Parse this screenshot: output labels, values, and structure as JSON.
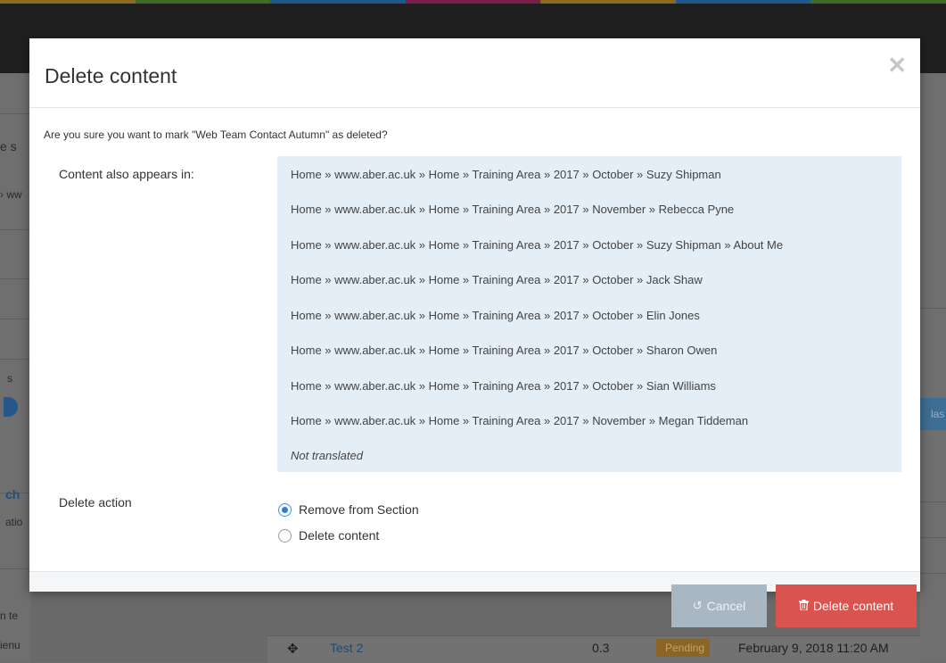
{
  "modal": {
    "title": "Delete content",
    "close_glyph": "✕",
    "question": "Are you sure you want to mark \"Web Team Contact Autumn\" as deleted?",
    "appears_label": "Content also appears in:",
    "appears_in": [
      "Home » www.aber.ac.uk » Home » Training Area » 2017 » October » Suzy Shipman",
      "Home » www.aber.ac.uk » Home » Training Area » 2017 » November » Rebecca Pyne",
      "Home » www.aber.ac.uk » Home » Training Area » 2017 » October » Suzy Shipman » About Me",
      "Home » www.aber.ac.uk » Home » Training Area » 2017 » October » Jack Shaw",
      "Home » www.aber.ac.uk » Home » Training Area » 2017 » October » Elin Jones",
      "Home » www.aber.ac.uk » Home » Training Area » 2017 » October » Sharon Owen",
      "Home » www.aber.ac.uk » Home » Training Area » 2017 » October » Sian Williams",
      "Home » www.aber.ac.uk » Home » Training Area » 2017 » November » Megan Tiddeman"
    ],
    "not_translated": "Not translated",
    "delete_action_label": "Delete action",
    "options": [
      {
        "label": "Remove from Section",
        "checked": true
      },
      {
        "label": "Delete content",
        "checked": false
      }
    ],
    "cancel_label": "Cancel",
    "cancel_icon": "undo-icon",
    "delete_label": "Delete content",
    "delete_icon": "trash-icon"
  },
  "background": {
    "row_title": "Test 2",
    "version": "0.3",
    "status": "Pending",
    "date": "February 9, 2018 11:20 AM",
    "fragments": [
      "e s",
      "› ww",
      "s",
      "ch",
      "atio",
      "n te",
      "ienu",
      "las"
    ]
  },
  "colors": {
    "accent": "#2d7fd6",
    "danger": "#d9534f",
    "cancel": "#a9b7c3",
    "info_box": "#e3eef6"
  }
}
